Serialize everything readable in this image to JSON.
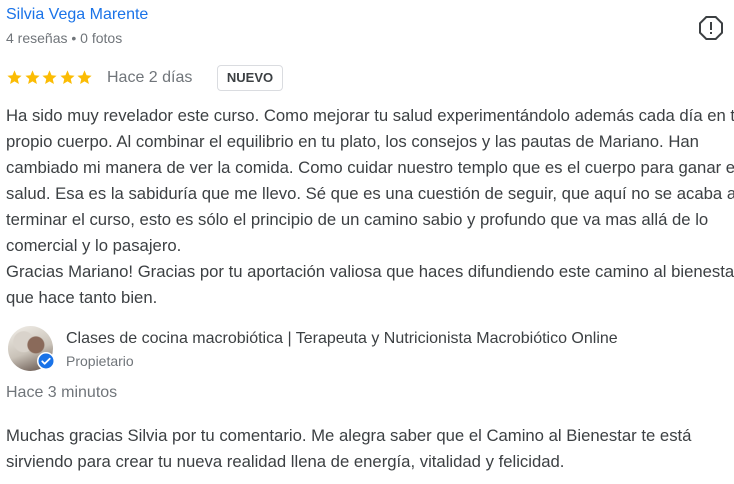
{
  "review": {
    "author": "Silvia Vega Marente",
    "author_meta": "4 reseñas • 0 fotos",
    "rating": 5,
    "date": "Hace 2 días",
    "badge": "NUEVO",
    "paragraphs": [
      "Ha sido muy revelador este curso. Como mejorar tu salud experimentándolo además cada día en tu propio cuerpo. Al combinar el equilibrio en tu plato, los consejos y las pautas de Mariano. Han cambiado mi manera de ver la comida. Como cuidar nuestro templo que es el cuerpo para ganar en salud. Esa es la sabiduría que me llevo. Sé que es una cuestión de seguir, que aquí no se acaba al terminar el curso, esto es sólo el principio de un camino sabio y profundo que va mas allá de lo comercial y lo pasajero.",
      "Gracias Mariano! Gracias por tu aportación valiosa que haces difundiendo este camino al bienestar, que hace tanto bien."
    ]
  },
  "reply": {
    "owner_name": "Clases de cocina macrobiótica | Terapeuta y Nutricionista Macrobiótico Online",
    "owner_role": "Propietario",
    "date": "Hace 3 minutos",
    "text": "Muchas gracias Silvia por tu comentario. Me alegra saber que el Camino al Bienestar te está sirviendo para crear tu nueva realidad llena de energía, vitalidad y felicidad."
  },
  "colors": {
    "author_link": "#1a73e8",
    "star": "#fbbc04",
    "verified": "#1a73e8",
    "secondary_text": "#70757a"
  },
  "icons": {
    "report": "report-flag-icon",
    "verified": "verified-check-icon",
    "star": "star-icon"
  }
}
